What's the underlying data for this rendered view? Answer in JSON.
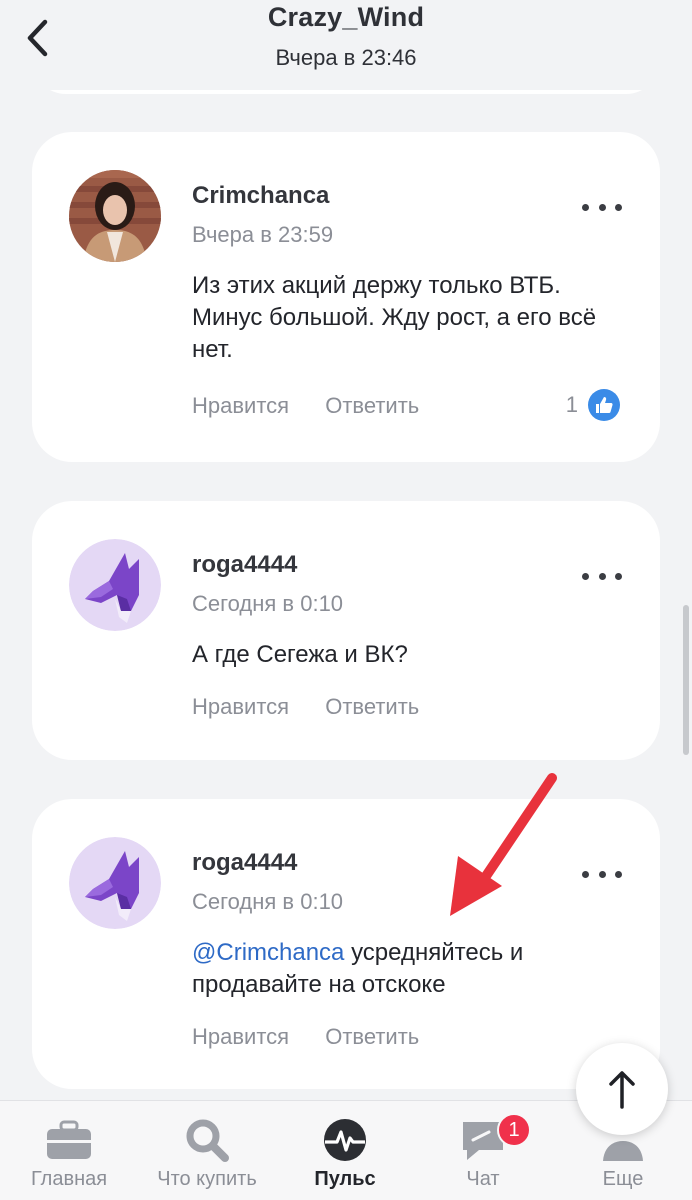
{
  "header": {
    "title": "Crazy_Wind",
    "subtitle": "Вчера в 23:46",
    "back_icon": "chevron-left-icon"
  },
  "comments": [
    {
      "author": "Crimchanca",
      "time": "Вчера в 23:59",
      "text": "Из этих акций держу только ВТБ. Минус большой. Жду рост, а его всё нет.",
      "like_label": "Нравится",
      "reply_label": "Ответить",
      "likes_count": "1"
    },
    {
      "author": "roga4444",
      "time": "Сегодня в 0:10",
      "text": "А где Сегежа и ВК?",
      "like_label": "Нравится",
      "reply_label": "Ответить"
    },
    {
      "author": "roga4444",
      "time": "Сегодня в 0:10",
      "mention": "@Crimchanca",
      "text": " усредняйтесь и продавайте на отскоке",
      "like_label": "Нравится",
      "reply_label": "Ответить"
    }
  ],
  "bottom_nav": [
    {
      "label": "Главная",
      "icon": "briefcase-icon"
    },
    {
      "label": "Что купить",
      "icon": "search-icon"
    },
    {
      "label": "Пульс",
      "icon": "pulse-icon",
      "active": true
    },
    {
      "label": "Чат",
      "icon": "chat-icon",
      "badge": "1"
    },
    {
      "label": "Еще",
      "icon": "profile-icon"
    }
  ],
  "colors": {
    "background": "#f2f3f5",
    "card": "#ffffff",
    "mention": "#2e6ac6",
    "like_badge": "#3a8be7",
    "badge": "#f0314b",
    "annotation_arrow": "#e8323c"
  }
}
